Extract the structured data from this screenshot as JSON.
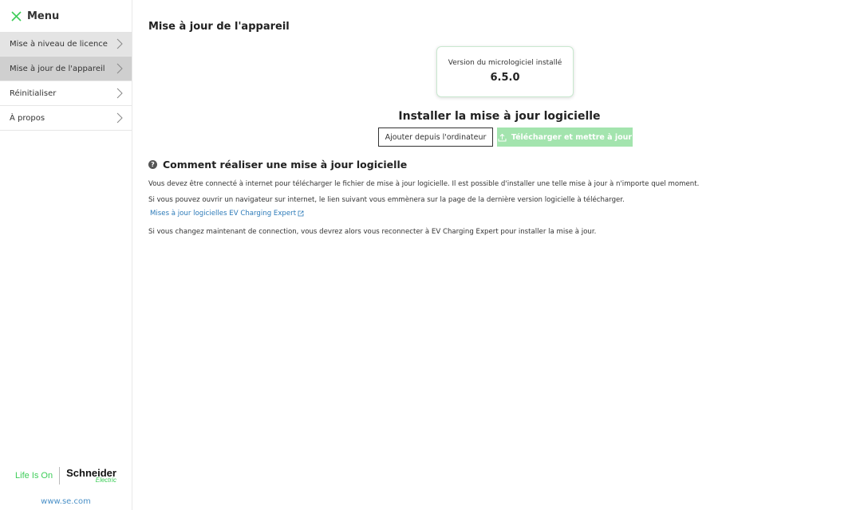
{
  "sidebar": {
    "menu_label": "Menu",
    "items": [
      {
        "label": "Mise à niveau de licence"
      },
      {
        "label": "Mise à jour de l'appareil"
      },
      {
        "label": "Réinitialiser"
      },
      {
        "label": "À propos"
      }
    ],
    "logo": {
      "tagline": "Life Is On",
      "brand": "Schneider",
      "brand_sub": "Electric"
    },
    "website": "www.se.com"
  },
  "main": {
    "title": "Mise à jour de l'appareil",
    "firmware": {
      "label": "Version du micrologiciel installé",
      "version": "6.5.0"
    },
    "install_title": "Installer la mise à jour logicielle",
    "add_from_computer_label": "Ajouter depuis l'ordinateur",
    "download_update_label": "Télécharger et mettre à jour",
    "howto": {
      "title": "Comment réaliser une mise à jour logicielle",
      "p1": "Vous devez être connecté à internet pour télécharger le fichier de mise à jour logicielle. Il est possible d'installer une telle mise à jour à n'importe quel moment.",
      "p2": "Si vous pouvez ouvrir un navigateur sur internet, le lien suivant vous emmènera sur la page de la dernière version logicielle à télécharger.",
      "link": "Mises à jour logicielles EV Charging Expert",
      "p3": "Si vous changez maintenant de connection, vous devrez alors vous reconnecter à EV Charging Expert pour installer la mise à jour."
    }
  },
  "colors": {
    "accent": "#3dcd58",
    "button_disabled": "#a3e4ae",
    "link": "#2d7bb9",
    "active_item": "#cfcfcf"
  },
  "icons": [
    "close-icon",
    "chevron-right-icon",
    "help-icon",
    "upload-icon",
    "external-link-icon"
  ]
}
